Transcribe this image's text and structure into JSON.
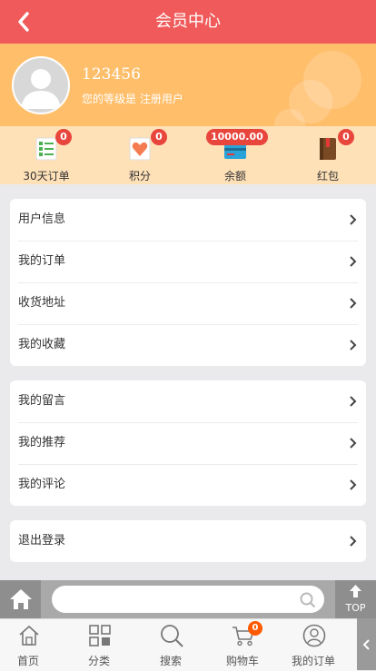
{
  "header": {
    "title": "会员中心"
  },
  "profile": {
    "username": "123456",
    "level_text": "您的等级是 注册用户"
  },
  "stats": [
    {
      "label": "30天订单",
      "badge": "0",
      "icon": "order-list-icon"
    },
    {
      "label": "积分",
      "badge": "0",
      "icon": "heart-points-icon"
    },
    {
      "label": "余额",
      "badge": "10000.00",
      "icon": "card-balance-icon"
    },
    {
      "label": "红包",
      "badge": "0",
      "icon": "red-packet-book-icon"
    }
  ],
  "menu_groups": [
    [
      "用户信息",
      "我的订单",
      "收货地址",
      "我的收藏"
    ],
    [
      "我的留言",
      "我的推荐",
      "我的评论"
    ],
    [
      "退出登录"
    ]
  ],
  "search": {
    "placeholder": "",
    "top_label": "TOP"
  },
  "tabbar": [
    {
      "label": "首页",
      "icon": "home-icon"
    },
    {
      "label": "分类",
      "icon": "category-grid-icon"
    },
    {
      "label": "搜索",
      "icon": "search-icon"
    },
    {
      "label": "购物车",
      "icon": "cart-icon",
      "badge": "0"
    },
    {
      "label": "我的订单",
      "icon": "user-circle-icon"
    }
  ],
  "colors": {
    "header": "#f05a5a",
    "profile": "#ffbe6a",
    "stats": "#ffe1b8",
    "badge": "#e8453c"
  }
}
